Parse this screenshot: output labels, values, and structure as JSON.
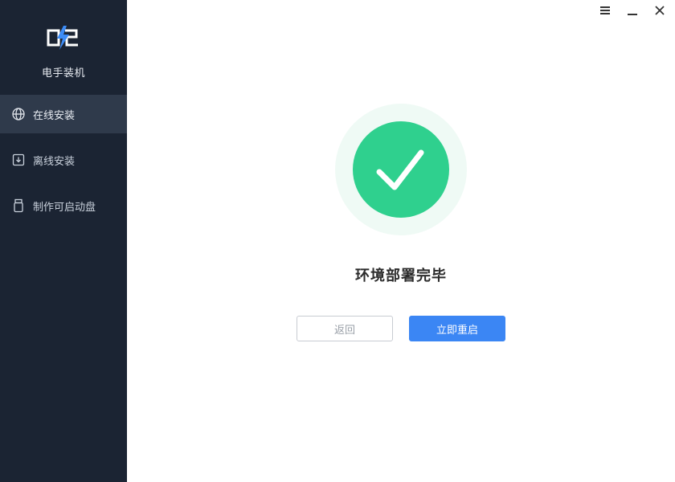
{
  "app": {
    "name": "电手装机"
  },
  "sidebar": {
    "items": [
      {
        "label": "在线安装",
        "icon": "globe-icon",
        "active": true
      },
      {
        "label": "离线安装",
        "icon": "download-box-icon",
        "active": false
      },
      {
        "label": "制作可启动盘",
        "icon": "usb-drive-icon",
        "active": false
      }
    ]
  },
  "window_controls": {
    "menu": "menu-icon",
    "minimize": "minimize-icon",
    "close": "close-icon"
  },
  "main": {
    "status_icon": "check-circle-icon",
    "title": "环境部署完毕",
    "back_label": "返回",
    "restart_label": "立即重启"
  },
  "colors": {
    "sidebar_bg": "#1b2433",
    "sidebar_active_bg": "#2f3a4b",
    "success_green": "#2fd08e",
    "success_halo": "#effaf5",
    "primary_blue": "#3b86f4",
    "logo_blue": "#3d8cf6"
  }
}
